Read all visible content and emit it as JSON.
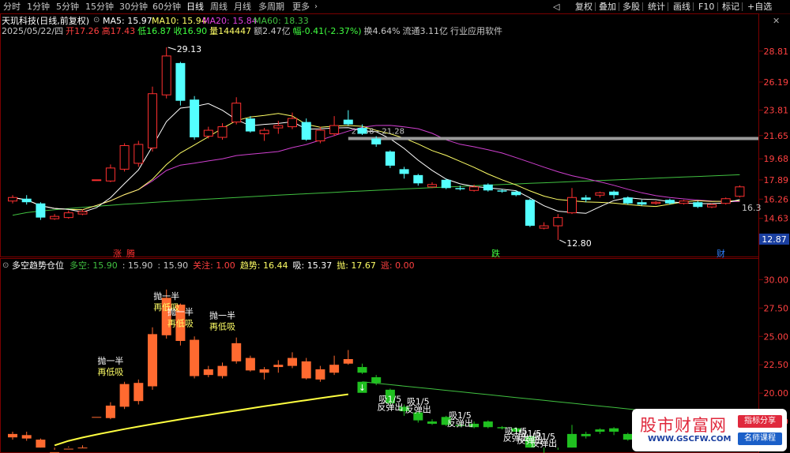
{
  "toolbar": {
    "periods": [
      "分时",
      "1分钟",
      "5分钟",
      "15分钟",
      "30分钟",
      "60分钟",
      "日线",
      "周线",
      "月线",
      "多周期",
      "更多"
    ],
    "active_period": "日线",
    "right_buttons": [
      "复权",
      "叠加",
      "多股",
      "统计",
      "画线",
      "F10",
      "标记",
      "+自选"
    ],
    "back_icon": "back-arrow-icon",
    "close_icon": "close-icon"
  },
  "main_chart": {
    "stock_title": "天玑科技(日线,前复权)",
    "ma_labels": [
      {
        "text": "MA5: 15.97",
        "color": "#ffffff"
      },
      {
        "text": "MA10: 15.94",
        "color": "#ffff66"
      },
      {
        "text": "MA20: 15.84",
        "color": "#e040e0"
      },
      {
        "text": "MA60: 18.33",
        "color": "#40c040"
      }
    ],
    "info_line": [
      {
        "text": "2025/05/22/四",
        "color": "#c8c8c8"
      },
      {
        "text": "开17.26",
        "color": "#ff4040"
      },
      {
        "text": "高17.43",
        "color": "#ff4040"
      },
      {
        "text": "低16.87",
        "color": "#40ff40"
      },
      {
        "text": "收16.90",
        "color": "#40ff40"
      },
      {
        "text": "量144447",
        "color": "#ffff66"
      },
      {
        "text": "额2.47亿",
        "color": "#c8c8c8"
      },
      {
        "text": "幅-0.41(-2.37%)",
        "color": "#40ff40"
      },
      {
        "text": "换4.64%",
        "color": "#c8c8c8"
      },
      {
        "text": "流通3.11亿",
        "color": "#c8c8c8"
      },
      {
        "text": "行业应用软件",
        "color": "#c8c8c8"
      }
    ],
    "y_ticks": [
      "28.81",
      "26.19",
      "23.81",
      "21.65",
      "19.68",
      "17.89",
      "16.26",
      "14.63"
    ],
    "current_price": "12.87",
    "annotations": {
      "high": "29.13",
      "low": "12.80",
      "support": "21.58 - 21.28",
      "right_price": "16.3"
    },
    "markers": [
      {
        "text": "涨",
        "color": "#ff3030"
      },
      {
        "text": "腾",
        "color": "#ff3030"
      },
      {
        "text": "跌",
        "color": "#40ff40"
      },
      {
        "text": "财",
        "color": "#3080ff"
      }
    ]
  },
  "indicator": {
    "title": "多空趋势仓位",
    "values": [
      {
        "text": "多空: 15.90",
        "color": "#40c040"
      },
      {
        "text": ": 15.90",
        "color": "#c8c8c8"
      },
      {
        "text": ": 15.90",
        "color": "#c8c8c8"
      },
      {
        "text": "关注: 1.00",
        "color": "#ff4040"
      },
      {
        "text": "趋势: 16.44",
        "color": "#ffff66"
      },
      {
        "text": "吸: 15.37",
        "color": "#ffffff"
      },
      {
        "text": "抛: 17.67",
        "color": "#ffff66"
      },
      {
        "text": "逃: 0.00",
        "color": "#ff4040"
      }
    ],
    "y_ticks": [
      "30.00",
      "27.50",
      "25.00",
      "22.50",
      "20.00",
      "17.50"
    ],
    "signal_a": "抛一半",
    "signal_b": "再低吸",
    "signal_c": "吸1/5",
    "signal_d": "反弹出"
  },
  "chart_data": {
    "type": "candlestick",
    "period": "daily",
    "main_y_range": [
      12.0,
      30.0
    ],
    "indicator_y_range": [
      15.0,
      31.0
    ],
    "candles": [
      {
        "o": 16.1,
        "c": 16.4,
        "h": 16.6,
        "l": 15.9
      },
      {
        "o": 16.3,
        "c": 16.0,
        "h": 16.6,
        "l": 15.8
      },
      {
        "o": 15.9,
        "c": 14.7,
        "h": 16.0,
        "l": 14.5
      },
      {
        "o": 14.6,
        "c": 14.8,
        "h": 15.0,
        "l": 14.5
      },
      {
        "o": 14.7,
        "c": 15.1,
        "h": 15.3,
        "l": 14.6
      },
      {
        "o": 15.0,
        "c": 15.2,
        "h": 15.4,
        "l": 14.9
      },
      {
        "o": 17.9,
        "c": 17.9,
        "h": 17.9,
        "l": 17.9
      },
      {
        "o": 17.8,
        "c": 18.9,
        "h": 19.2,
        "l": 17.7
      },
      {
        "o": 18.8,
        "c": 20.8,
        "h": 21.0,
        "l": 18.6
      },
      {
        "o": 19.3,
        "c": 20.9,
        "h": 21.2,
        "l": 19.0
      },
      {
        "o": 20.6,
        "c": 25.2,
        "h": 25.8,
        "l": 20.3
      },
      {
        "o": 25.1,
        "c": 28.4,
        "h": 29.13,
        "l": 24.8
      },
      {
        "o": 27.8,
        "c": 24.6,
        "h": 27.9,
        "l": 24.2
      },
      {
        "o": 24.7,
        "c": 21.5,
        "h": 25.0,
        "l": 21.3
      },
      {
        "o": 21.6,
        "c": 22.1,
        "h": 22.4,
        "l": 21.4
      },
      {
        "o": 21.5,
        "c": 22.4,
        "h": 22.7,
        "l": 21.3
      },
      {
        "o": 22.8,
        "c": 24.4,
        "h": 24.9,
        "l": 22.6
      },
      {
        "o": 23.1,
        "c": 22.0,
        "h": 23.3,
        "l": 21.9
      },
      {
        "o": 21.8,
        "c": 22.1,
        "h": 22.3,
        "l": 21.2
      },
      {
        "o": 22.3,
        "c": 22.5,
        "h": 22.9,
        "l": 21.8
      },
      {
        "o": 22.4,
        "c": 23.1,
        "h": 23.6,
        "l": 22.2
      },
      {
        "o": 22.8,
        "c": 21.3,
        "h": 23.1,
        "l": 21.2
      },
      {
        "o": 21.2,
        "c": 22.1,
        "h": 22.4,
        "l": 21.0
      },
      {
        "o": 21.8,
        "c": 22.5,
        "h": 23.3,
        "l": 21.6
      },
      {
        "o": 23.0,
        "c": 22.6,
        "h": 23.8,
        "l": 22.5
      },
      {
        "o": 22.3,
        "c": 21.8,
        "h": 22.6,
        "l": 21.7
      },
      {
        "o": 21.4,
        "c": 20.9,
        "h": 21.6,
        "l": 20.7
      },
      {
        "o": 20.3,
        "c": 19.1,
        "h": 20.4,
        "l": 18.9
      },
      {
        "o": 18.8,
        "c": 18.4,
        "h": 19.0,
        "l": 18.0
      },
      {
        "o": 18.3,
        "c": 17.6,
        "h": 18.4,
        "l": 17.4
      },
      {
        "o": 17.3,
        "c": 17.5,
        "h": 17.7,
        "l": 17.2
      },
      {
        "o": 17.9,
        "c": 17.2,
        "h": 18.0,
        "l": 17.1
      },
      {
        "o": 17.2,
        "c": 17.1,
        "h": 17.4,
        "l": 17.0
      },
      {
        "o": 17.0,
        "c": 17.3,
        "h": 17.5,
        "l": 16.9
      },
      {
        "o": 17.5,
        "c": 17.0,
        "h": 17.6,
        "l": 16.9
      },
      {
        "o": 17.0,
        "c": 16.9,
        "h": 17.1,
        "l": 16.8
      },
      {
        "o": 16.9,
        "c": 16.6,
        "h": 17.0,
        "l": 16.5
      },
      {
        "o": 16.2,
        "c": 14.0,
        "h": 16.3,
        "l": 13.9
      },
      {
        "o": 13.8,
        "c": 14.0,
        "h": 14.3,
        "l": 13.7
      },
      {
        "o": 14.0,
        "c": 14.7,
        "h": 15.0,
        "l": 12.8
      },
      {
        "o": 15.1,
        "c": 16.4,
        "h": 17.2,
        "l": 15.0
      },
      {
        "o": 16.4,
        "c": 16.2,
        "h": 16.6,
        "l": 16.0
      },
      {
        "o": 16.6,
        "c": 16.8,
        "h": 16.9,
        "l": 16.4
      },
      {
        "o": 16.9,
        "c": 16.6,
        "h": 17.0,
        "l": 16.3
      },
      {
        "o": 16.4,
        "c": 15.9,
        "h": 16.5,
        "l": 15.8
      },
      {
        "o": 16.0,
        "c": 15.8,
        "h": 16.2,
        "l": 15.7
      },
      {
        "o": 15.9,
        "c": 16.0,
        "h": 16.1,
        "l": 15.8
      },
      {
        "o": 16.2,
        "c": 15.9,
        "h": 16.3,
        "l": 15.8
      },
      {
        "o": 15.9,
        "c": 16.1,
        "h": 16.2,
        "l": 15.8
      },
      {
        "o": 16.0,
        "c": 15.6,
        "h": 16.1,
        "l": 15.5
      },
      {
        "o": 15.6,
        "c": 15.8,
        "h": 15.9,
        "l": 15.5
      },
      {
        "o": 15.9,
        "c": 16.3,
        "h": 16.4,
        "l": 15.8
      },
      {
        "o": 16.5,
        "c": 17.3,
        "h": 17.43,
        "l": 16.4
      }
    ],
    "support_line": 21.4
  }
}
